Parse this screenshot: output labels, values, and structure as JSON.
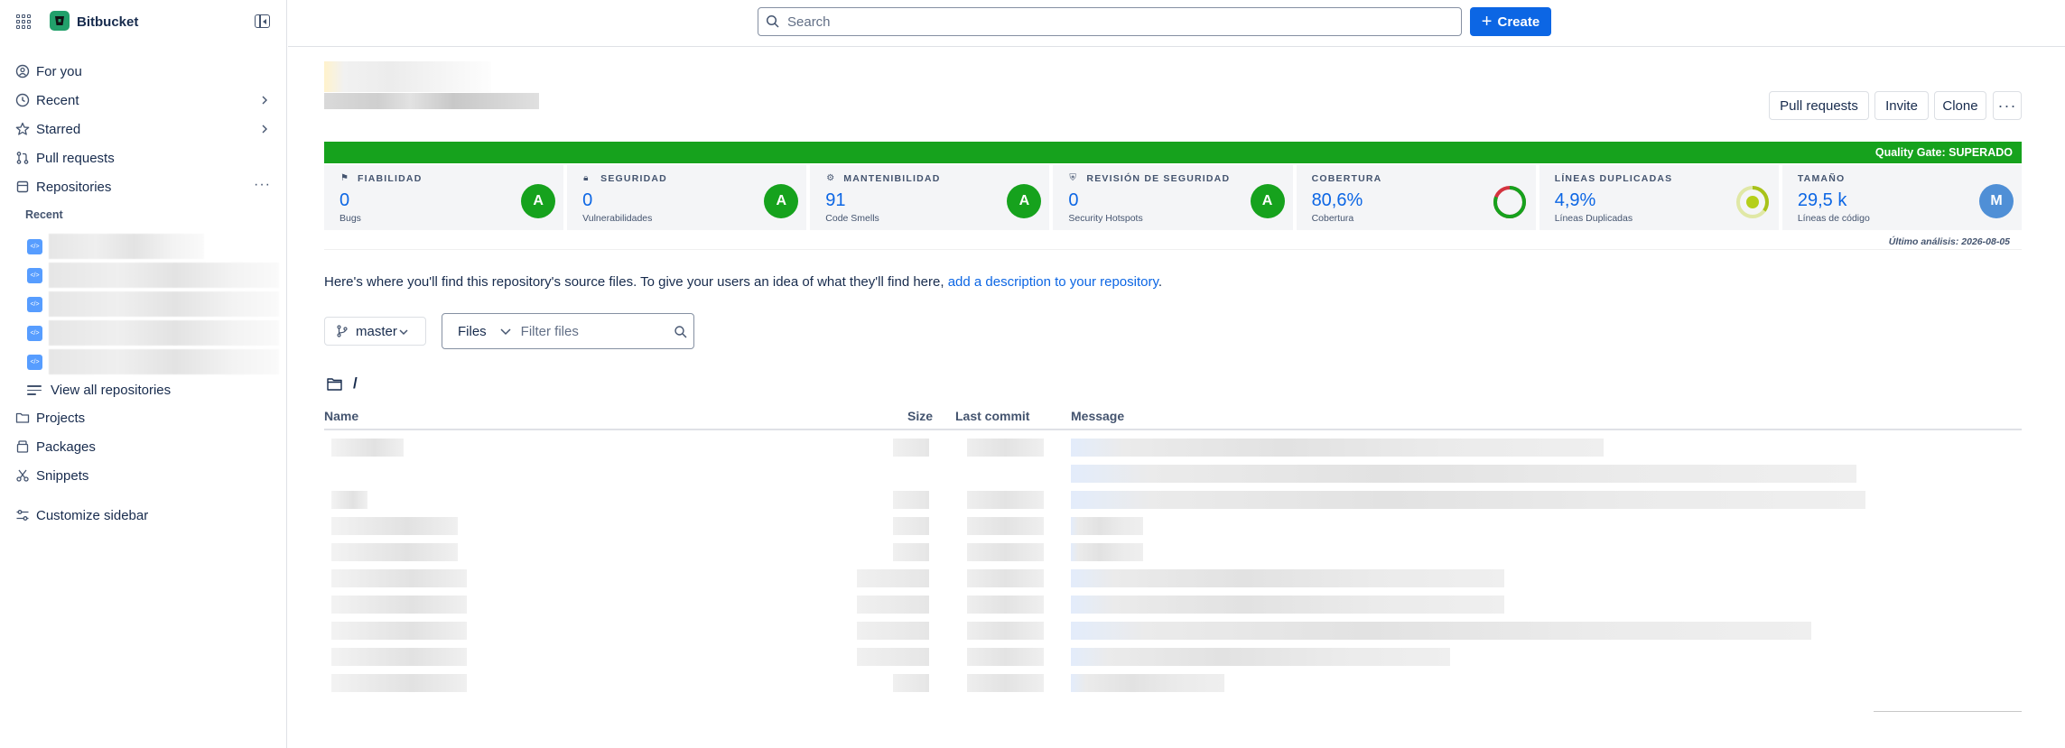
{
  "app": {
    "name": "Bitbucket"
  },
  "topbar": {
    "search_placeholder": "Search",
    "create_label": "Create"
  },
  "sidebar": {
    "items": [
      {
        "label": "For you",
        "icon": "for-you-icon"
      },
      {
        "label": "Recent",
        "icon": "clock-icon"
      },
      {
        "label": "Starred",
        "icon": "star-icon"
      },
      {
        "label": "Pull requests",
        "icon": "pull-request-icon"
      },
      {
        "label": "Repositories",
        "icon": "repository-icon"
      }
    ],
    "recent_label": "Recent",
    "view_all": "View all repositories",
    "bottom_items": [
      {
        "label": "Projects",
        "icon": "folder-icon"
      },
      {
        "label": "Packages",
        "icon": "package-icon"
      },
      {
        "label": "Snippets",
        "icon": "scissors-icon"
      }
    ],
    "customize": "Customize sidebar",
    "repo_avatar_text": "</>"
  },
  "repo": {
    "actions": [
      "Pull requests",
      "Invite",
      "Clone"
    ],
    "more": "···"
  },
  "quality": {
    "gate": "Quality Gate: SUPERADO",
    "metrics": [
      {
        "name": "FIABILIDAD",
        "value": "0",
        "sub": "Bugs",
        "grade": "A",
        "icon": "bug-icon"
      },
      {
        "name": "SEGURIDAD",
        "value": "0",
        "sub": "Vulnerabilidades",
        "grade": "A",
        "icon": "lock-icon"
      },
      {
        "name": "MANTENIBILIDAD",
        "value": "91",
        "sub": "Code Smells",
        "grade": "A",
        "icon": "maintainability-icon"
      },
      {
        "name": "REVISIÓN DE SEGURIDAD",
        "value": "0",
        "sub": "Security Hotspots",
        "grade": "A",
        "icon": "shield-icon"
      },
      {
        "name": "COBERTURA",
        "value": "80,6%",
        "sub": "Cobertura",
        "donut": 0.806
      },
      {
        "name": "LÍNEAS DUPLICADAS",
        "value": "4,9%",
        "sub": "Líneas Duplicadas",
        "donut": 0.049
      },
      {
        "name": "TAMAÑO",
        "value": "29,5 k",
        "sub": "Líneas de código",
        "grade": "M"
      }
    ],
    "last_analysis": "Último análisis: 2026-08-05"
  },
  "description": {
    "text": "Here's where you'll find this repository's source files. To give your users an idea of what they'll find here, ",
    "link": "add a description to your repository",
    "suffix": "."
  },
  "files": {
    "branch": "master",
    "filter_label": "Files",
    "filter_placeholder": "Filter files",
    "path": "/",
    "columns": [
      "Name",
      "Size",
      "Last commit",
      "Message"
    ]
  },
  "colors": {
    "accent": "#0c66e4",
    "quality_green": "#16a21d",
    "maintain_blue": "#4f8fd6"
  }
}
